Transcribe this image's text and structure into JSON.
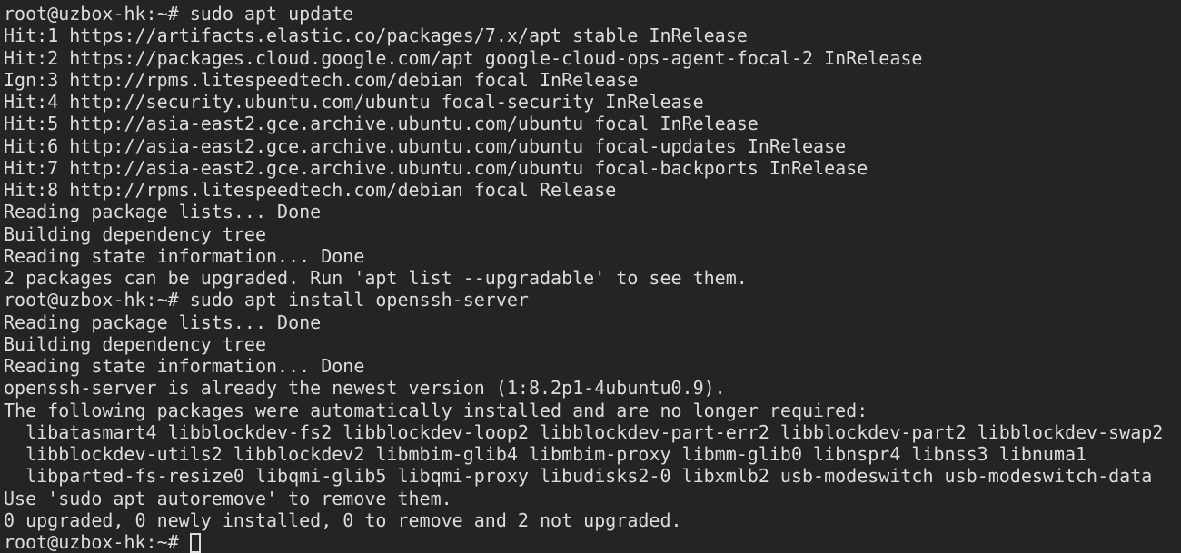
{
  "terminal": {
    "background_color": "#242424",
    "foreground_color": "#dcdcdc",
    "prompt": "root@uzbox-hk:~#",
    "cursor": {
      "style": "hollow-block",
      "color": "#dcdcdc"
    },
    "lines": [
      "root@uzbox-hk:~# sudo apt update",
      "Hit:1 https://artifacts.elastic.co/packages/7.x/apt stable InRelease",
      "Hit:2 https://packages.cloud.google.com/apt google-cloud-ops-agent-focal-2 InRelease",
      "Ign:3 http://rpms.litespeedtech.com/debian focal InRelease",
      "Hit:4 http://security.ubuntu.com/ubuntu focal-security InRelease",
      "Hit:5 http://asia-east2.gce.archive.ubuntu.com/ubuntu focal InRelease",
      "Hit:6 http://asia-east2.gce.archive.ubuntu.com/ubuntu focal-updates InRelease",
      "Hit:7 http://asia-east2.gce.archive.ubuntu.com/ubuntu focal-backports InRelease",
      "Hit:8 http://rpms.litespeedtech.com/debian focal Release",
      "Reading package lists... Done",
      "Building dependency tree",
      "Reading state information... Done",
      "2 packages can be upgraded. Run 'apt list --upgradable' to see them.",
      "root@uzbox-hk:~# sudo apt install openssh-server",
      "Reading package lists... Done",
      "Building dependency tree",
      "Reading state information... Done",
      "openssh-server is already the newest version (1:8.2p1-4ubuntu0.9).",
      "The following packages were automatically installed and are no longer required:",
      "  libatasmart4 libblockdev-fs2 libblockdev-loop2 libblockdev-part-err2 libblockdev-part2 libblockdev-swap2",
      "  libblockdev-utils2 libblockdev2 libmbim-glib4 libmbim-proxy libmm-glib0 libnspr4 libnss3 libnuma1",
      "  libparted-fs-resize0 libqmi-glib5 libqmi-proxy libudisks2-0 libxmlb2 usb-modeswitch usb-modeswitch-data",
      "Use 'sudo apt autoremove' to remove them.",
      "0 upgraded, 0 newly installed, 0 to remove and 2 not upgraded."
    ],
    "final_prompt": "root@uzbox-hk:~# "
  }
}
